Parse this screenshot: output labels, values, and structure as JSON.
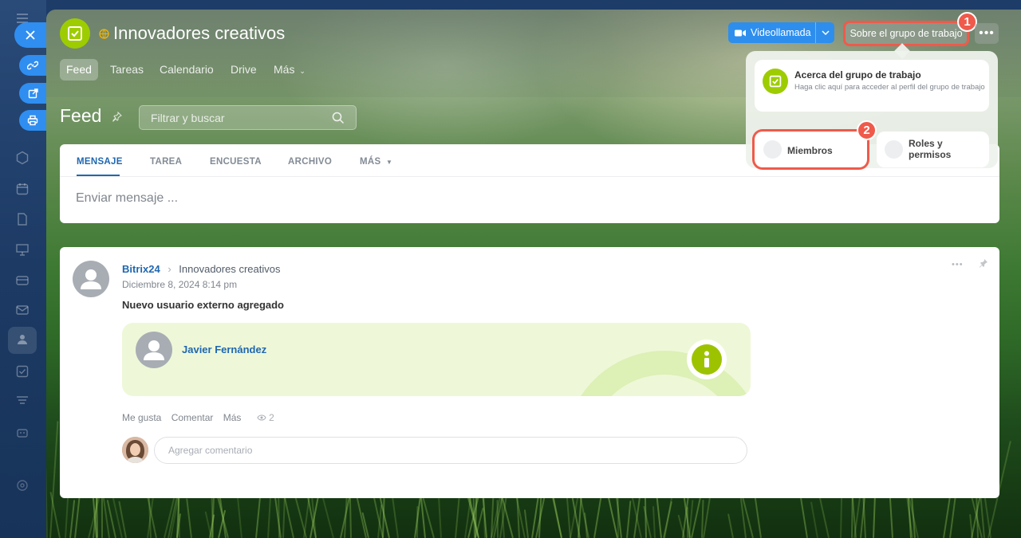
{
  "colors": {
    "accent": "#2d8eee",
    "group_logo": "#9dcc00",
    "highlight": "#ef5a4b",
    "link": "#2067b0",
    "info_badge": "#9dc300"
  },
  "sidebar": {
    "icons": [
      "menu-icon",
      "close-icon",
      "link-icon",
      "external-link-icon",
      "print-icon",
      "hexagon-icon",
      "calendar-icon",
      "document-icon",
      "presentation-icon",
      "card-icon",
      "mail-icon",
      "group-icon",
      "checkbox-icon",
      "filter-icon",
      "robot-icon",
      "settings-icon"
    ]
  },
  "header": {
    "group_title": "Innovadores creativos",
    "nav_tabs": [
      {
        "label": "Feed"
      },
      {
        "label": "Tareas"
      },
      {
        "label": "Calendario"
      },
      {
        "label": "Drive"
      },
      {
        "label": "Más"
      }
    ],
    "video_call_label": "Videollamada",
    "about_label": "Sobre el grupo de trabajo",
    "step1": "1",
    "step2": "2"
  },
  "popup": {
    "about_title": "Acerca del grupo de trabajo",
    "about_desc": "Haga clic aquí para acceder al perfil del grupo de trabajo",
    "members_label": "Miembros",
    "roles_label": "Roles y permisos"
  },
  "feed": {
    "title": "Feed",
    "search_placeholder": "Filtrar y buscar",
    "composer_tabs": [
      "MENSAJE",
      "TAREA",
      "ENCUESTA",
      "ARCHIVO",
      "MÁS"
    ],
    "composer_placeholder": "Enviar mensaje ..."
  },
  "post": {
    "author": "Bitrix24",
    "destination": "Innovadores creativos",
    "date": "Diciembre 8, 2024 8:14 pm",
    "title": "Nuevo usuario externo agregado",
    "user_name": "Javier Fernández",
    "actions": {
      "like": "Me gusta",
      "comment": "Comentar",
      "more": "Más"
    },
    "views": "2",
    "comment_placeholder": "Agregar comentario"
  }
}
